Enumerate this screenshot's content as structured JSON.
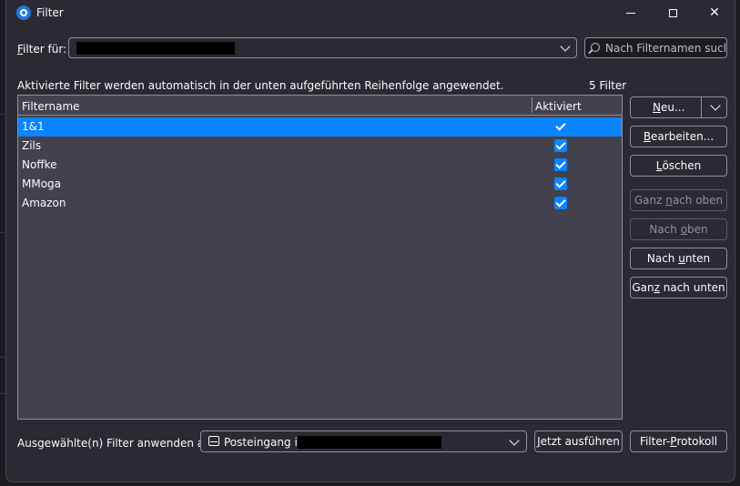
{
  "window": {
    "title": "Filter"
  },
  "filter_for": {
    "label_accesskey": "F",
    "label_rest": "ilter für:"
  },
  "search": {
    "placeholder": "Nach Filternamen suchen"
  },
  "info": {
    "text": "Aktivierte Filter werden automatisch in der unten aufgeführten Reihenfolge angewendet.",
    "count": "5 Filter"
  },
  "list": {
    "headers": {
      "name": "Filtername",
      "enabled": "Aktiviert"
    },
    "rows": [
      {
        "name": "1&1",
        "enabled": true
      },
      {
        "name": "Zils",
        "enabled": true
      },
      {
        "name": "Noffke",
        "enabled": true
      },
      {
        "name": "MMoga",
        "enabled": true
      },
      {
        "name": "Amazon",
        "enabled": true
      }
    ]
  },
  "buttons": {
    "new": {
      "ak": "N",
      "rest": "eu..."
    },
    "edit": {
      "ak": "B",
      "rest": "earbeiten..."
    },
    "delete": {
      "ak": "L",
      "rest": "öschen"
    },
    "top": {
      "pre": "Ganz ",
      "ak": "n",
      "post": "ach oben"
    },
    "up": {
      "pre": "Nach ",
      "ak": "o",
      "post": "ben"
    },
    "down": {
      "pre": "Nach ",
      "ak": "u",
      "post": "nten"
    },
    "bottom": {
      "pre": "Gan",
      "ak": "z",
      "post": " nach unten"
    }
  },
  "apply": {
    "label": "Ausgewählte(n) Filter anwenden auf:",
    "folder_prefix": "Posteingang in",
    "run": {
      "ak": "J",
      "rest": "etzt ausführen"
    },
    "log": {
      "pre": "Filter-",
      "ak": "P",
      "post": "rotokoll"
    }
  },
  "colors": {
    "accent": "#0a84ff",
    "panel": "#2b2a33",
    "list_bg": "#42414d"
  }
}
